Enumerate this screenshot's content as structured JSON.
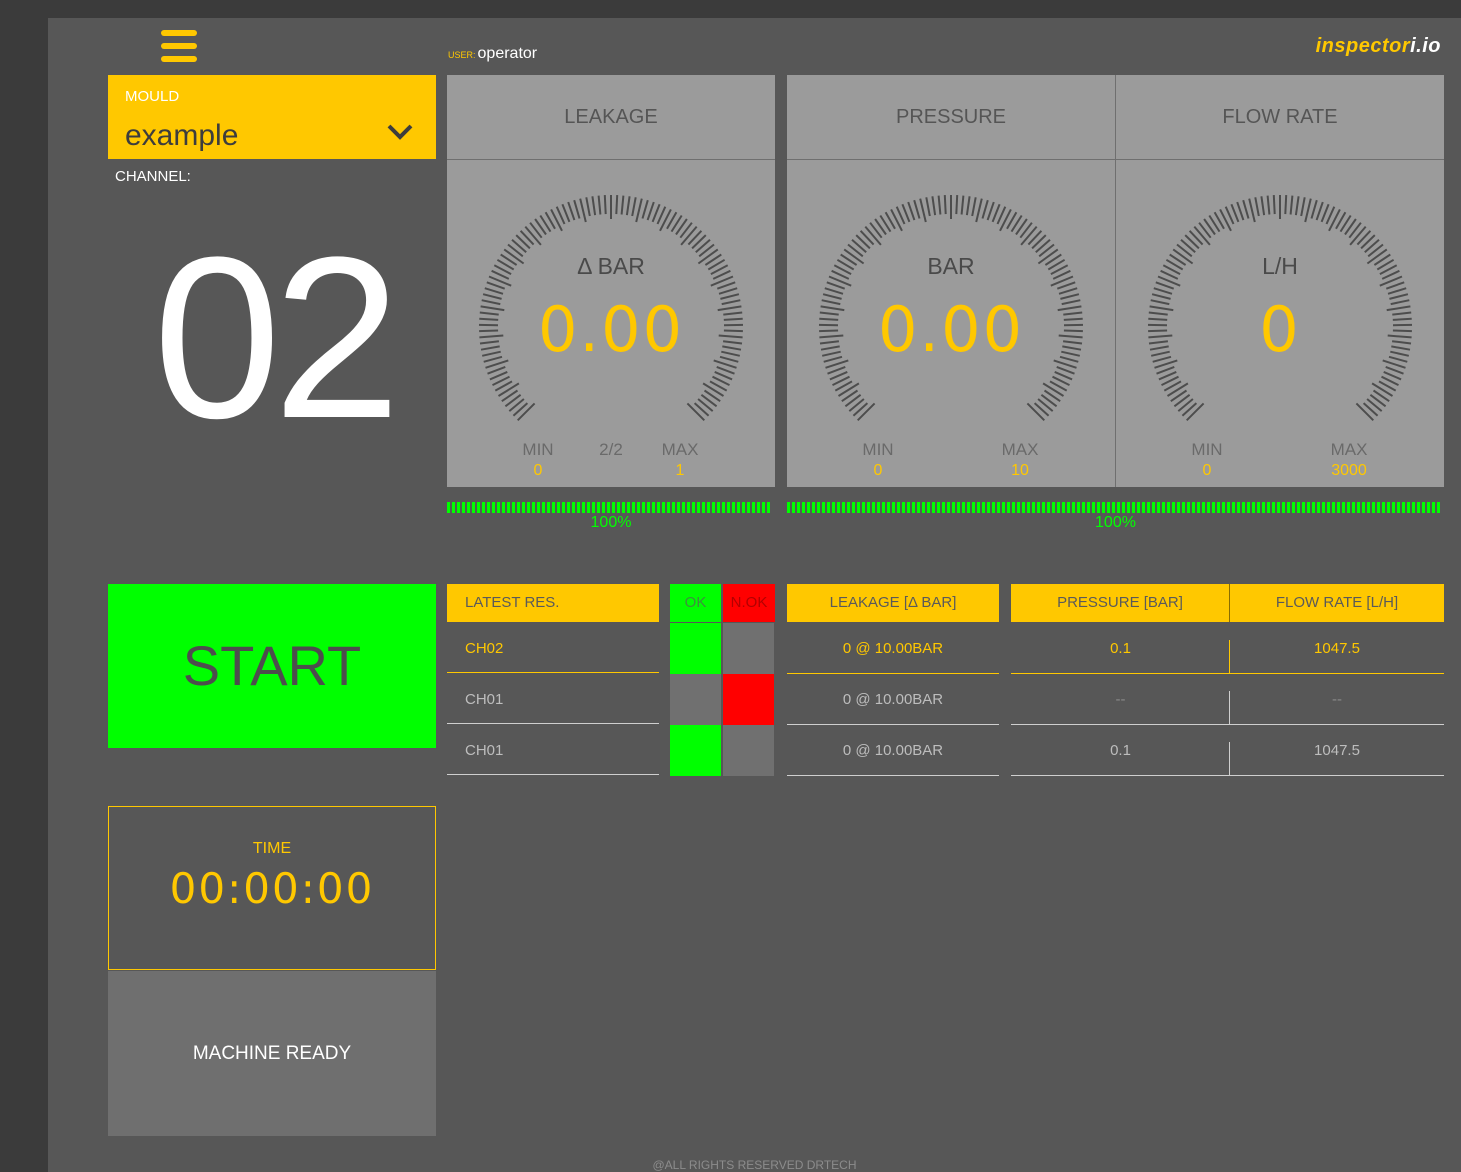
{
  "header": {
    "user_label": "USER:",
    "user_name": "operator",
    "logo_main": "inspector",
    "logo_accent": "i.io"
  },
  "mould": {
    "label": "MOULD",
    "value": "example"
  },
  "channel": {
    "label": "CHANNEL:",
    "number": "02"
  },
  "gauges": [
    {
      "title": "LEAKAGE",
      "unit": "Δ BAR",
      "value": "0.00",
      "min_label": "MIN",
      "min": "0",
      "max_label": "MAX",
      "max": "1",
      "middle": "2/2"
    },
    {
      "title": "PRESSURE",
      "unit": "BAR",
      "value": "0.00",
      "min_label": "MIN",
      "min": "0",
      "max_label": "MAX",
      "max": "10"
    },
    {
      "title": "FLOW RATE",
      "unit": "L/H",
      "value": "0",
      "min_label": "MIN",
      "min": "0",
      "max_label": "MAX",
      "max": "3000"
    }
  ],
  "progress": [
    {
      "percent_label": "100%",
      "fraction": 1.0
    },
    {
      "percent_label": "100%",
      "fraction": 1.0
    }
  ],
  "start_button": {
    "label": "START"
  },
  "results": {
    "headers": {
      "latest": "LATEST RES.",
      "ok": "OK",
      "nok": "N.OK",
      "leakage": "LEAKAGE [Δ BAR]",
      "pressure": "PRESSURE [BAR]",
      "flow": "FLOW RATE [L/H]"
    },
    "rows": [
      {
        "channel": "CH02",
        "status": "ok",
        "leakage": "0 @ 10.00BAR",
        "pressure": "0.1",
        "flow": "1047.5"
      },
      {
        "channel": "CH01",
        "status": "nok",
        "leakage": "0 @ 10.00BAR",
        "pressure": "--",
        "flow": "--"
      },
      {
        "channel": "CH01",
        "status": "ok",
        "leakage": "0 @ 10.00BAR",
        "pressure": "0.1",
        "flow": "1047.5"
      }
    ]
  },
  "timer": {
    "label": "TIME",
    "value": "00:00:00"
  },
  "status": {
    "text": "MACHINE READY"
  },
  "footer": {
    "text": "@ALL RIGHTS RESERVED DRTECH"
  },
  "colors": {
    "accent": "#ffc800",
    "ok": "#00ff00",
    "nok": "#ff0000",
    "background": "#575757",
    "panel": "#9b9b9b"
  }
}
